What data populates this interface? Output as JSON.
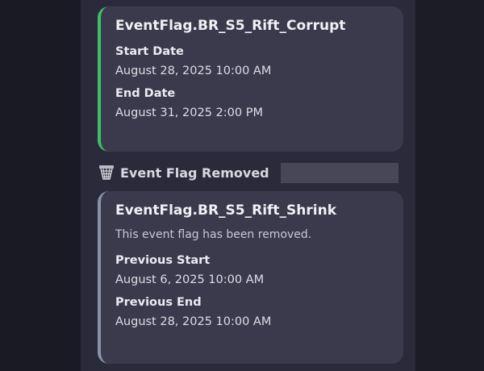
{
  "first_embed": {
    "title": "EventFlag.BR_S5_Rift_Corrupt",
    "start_label": "Start Date",
    "start_value": "August 28, 2025 10:00 AM",
    "end_label": "End Date",
    "end_value": "August 31, 2025 2:00 PM",
    "accent_color": "#3ac16a"
  },
  "removed_header": {
    "icon": "basketball-hoop-icon",
    "text": "Event Flag Removed"
  },
  "second_embed": {
    "title": "EventFlag.BR_S5_Rift_Shrink",
    "description": "This event flag has been removed.",
    "prev_start_label": "Previous Start",
    "prev_start_value": "August 6, 2025 10:00 AM",
    "prev_end_label": "Previous End",
    "prev_end_value": "August 28, 2025 10:00 AM",
    "accent_color": "#8a93a8"
  }
}
